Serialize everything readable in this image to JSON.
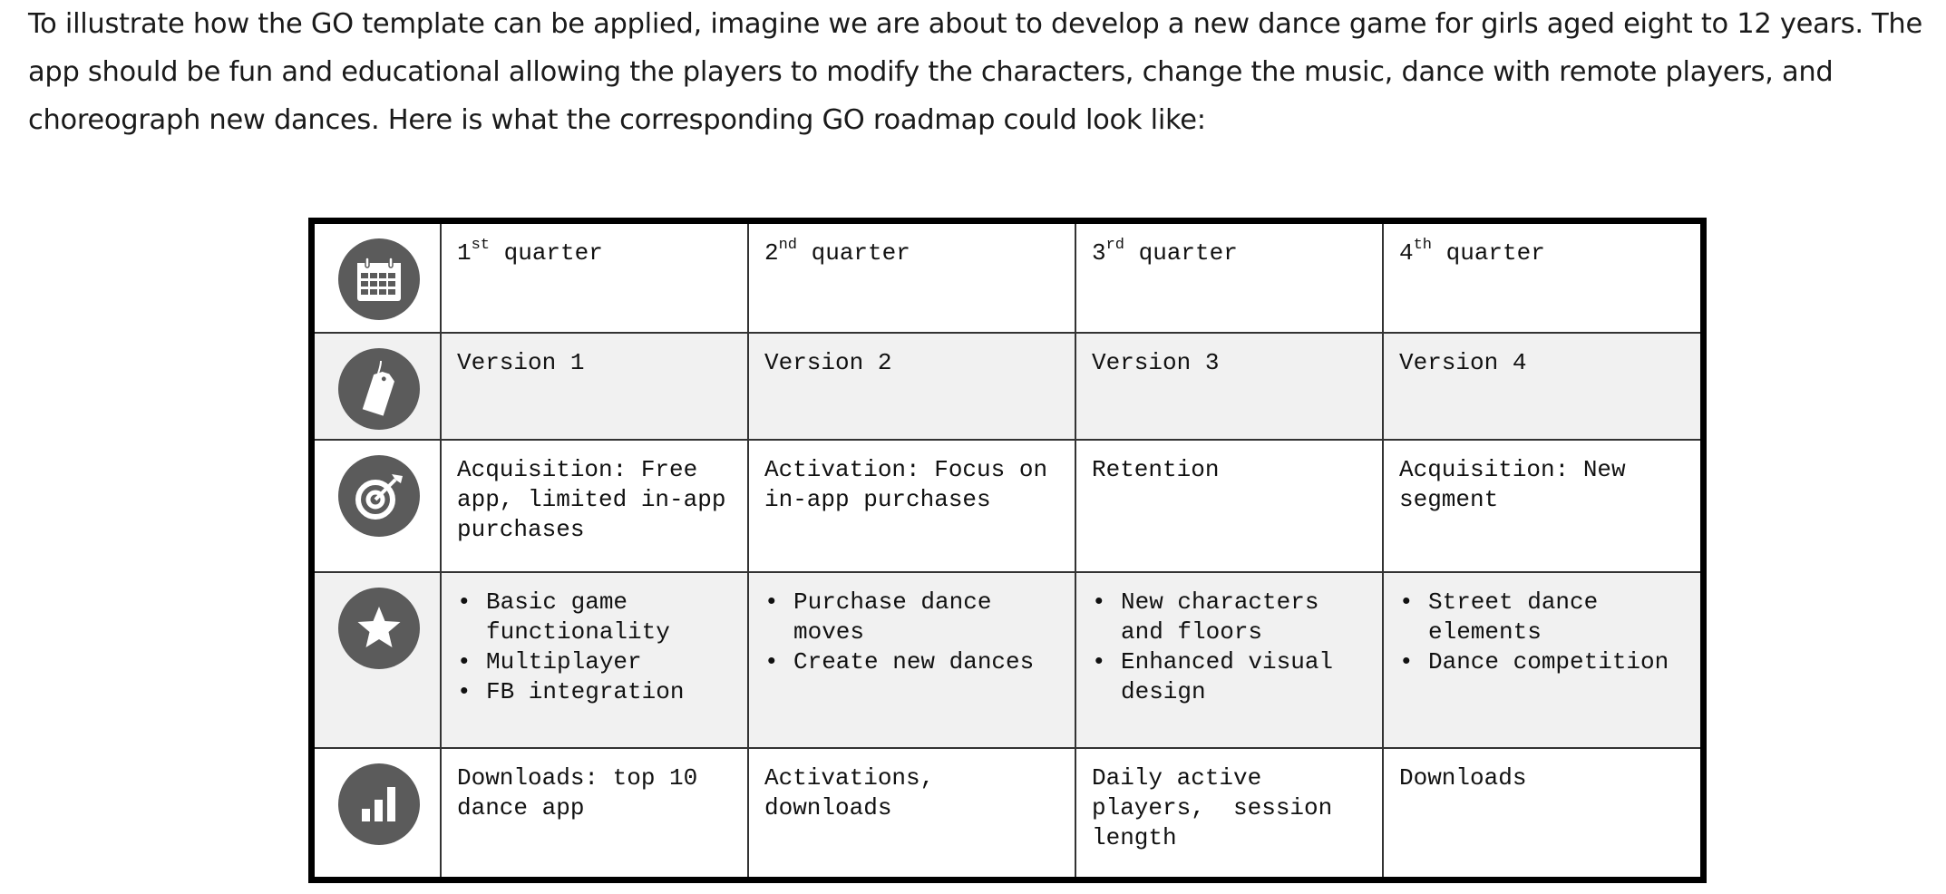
{
  "intro": "To illustrate how the GO template can be applied, imagine we are about to develop a new dance game for girls aged eight to 12 years. The app should be fun and educational allowing the players to modify the characters, change the music, dance with remote players, and choreograph new dances. Here is what the corresponding GO roadmap could look like:",
  "roadmap": {
    "icon_color": "#5b5b5b",
    "quarters": [
      {
        "num": "1",
        "suffix": "st",
        "word": "quarter"
      },
      {
        "num": "2",
        "suffix": "nd",
        "word": "quarter"
      },
      {
        "num": "3",
        "suffix": "rd",
        "word": "quarter"
      },
      {
        "num": "4",
        "suffix": "th",
        "word": "quarter"
      }
    ],
    "versions": [
      "Version 1",
      "Version 2",
      "Version 3",
      "Version 4"
    ],
    "goals": [
      "Acquisition: Free app, limited in-app purchases",
      "Activation: Focus on in-app purchases",
      "Retention",
      "Acquisition: New segment"
    ],
    "features": [
      [
        "Basic game functionality",
        "Multiplayer",
        "FB integration"
      ],
      [
        "Purchase dance moves",
        "Create new dances"
      ],
      [
        "New characters and floors",
        "Enhanced visual design"
      ],
      [
        "Street dance elements",
        "Dance competition"
      ]
    ],
    "metrics": [
      "Downloads: top 10 dance app",
      "Activations, downloads",
      "Daily active players,  session length",
      "Downloads"
    ]
  }
}
